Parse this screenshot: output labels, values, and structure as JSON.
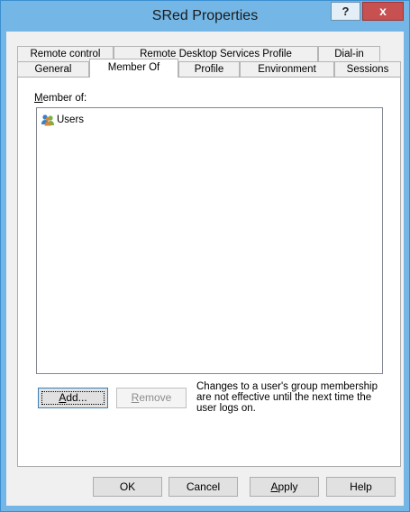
{
  "window": {
    "title": "SRed Properties",
    "help_glyph": "?",
    "close_glyph": "x"
  },
  "tabs": {
    "row1": [
      "Remote control",
      "Remote Desktop Services Profile",
      "Dial-in"
    ],
    "row2": [
      "General",
      "Member Of",
      "Profile",
      "Environment",
      "Sessions"
    ],
    "active": "Member Of"
  },
  "member_of": {
    "label_prefix": "M",
    "label_rest": "ember of:",
    "items": [
      {
        "name": "Users",
        "icon": "users-group-icon"
      }
    ]
  },
  "buttons": {
    "add_prefix": "A",
    "add_rest": "dd...",
    "remove_prefix": "R",
    "remove_rest": "emove"
  },
  "note": "Changes to a user's group membership are not effective until the next time the user logs on.",
  "footer": {
    "ok": "OK",
    "cancel": "Cancel",
    "apply_prefix": "A",
    "apply_rest": "pply",
    "help": "Help"
  },
  "colors": {
    "title_bar": "#74b7e6",
    "close_button": "#c75050",
    "dialog_bg": "#f0f0f0"
  }
}
